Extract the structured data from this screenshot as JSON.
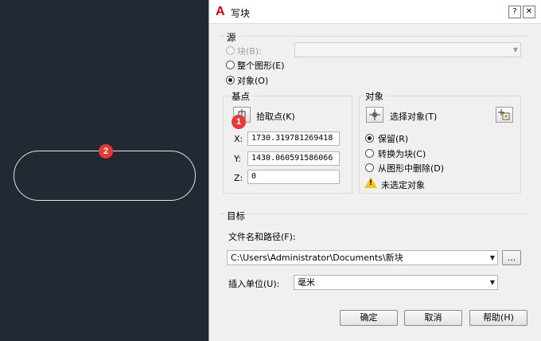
{
  "dialog": {
    "title": "写块",
    "help": "?",
    "close": "✕"
  },
  "source": {
    "legend": "源",
    "block_label": "块(B):",
    "entire_drawing_label": "整个图形(E)",
    "objects_label": "对象(O)",
    "selected": "objects"
  },
  "basepoint": {
    "legend": "基点",
    "pick_label": "拾取点(K)",
    "x_label": "X:",
    "x_value": "1730.319781269418",
    "y_label": "Y:",
    "y_value": "1430.060591586066",
    "z_label": "Z:",
    "z_value": "0"
  },
  "objects": {
    "legend": "对象",
    "select_label": "选择对象(T)",
    "retain_label": "保留(R)",
    "convert_label": "转换为块(C)",
    "delete_label": "从图形中删除(D)",
    "selected": "retain",
    "warning": "未选定对象"
  },
  "destination": {
    "legend": "目标",
    "filename_label": "文件名和路径(F):",
    "filename_value": "C:\\Users\\Administrator\\Documents\\新块",
    "browse_label": "...",
    "units_label": "插入单位(U):",
    "units_value": "毫米"
  },
  "buttons": {
    "ok": "确定",
    "cancel": "取消",
    "help": "帮助(H)"
  },
  "markers": {
    "one": "1",
    "two": "2"
  },
  "colors": {
    "canvas_bg": "#222933",
    "marker": "#e53935",
    "warning": "#f5c518"
  }
}
